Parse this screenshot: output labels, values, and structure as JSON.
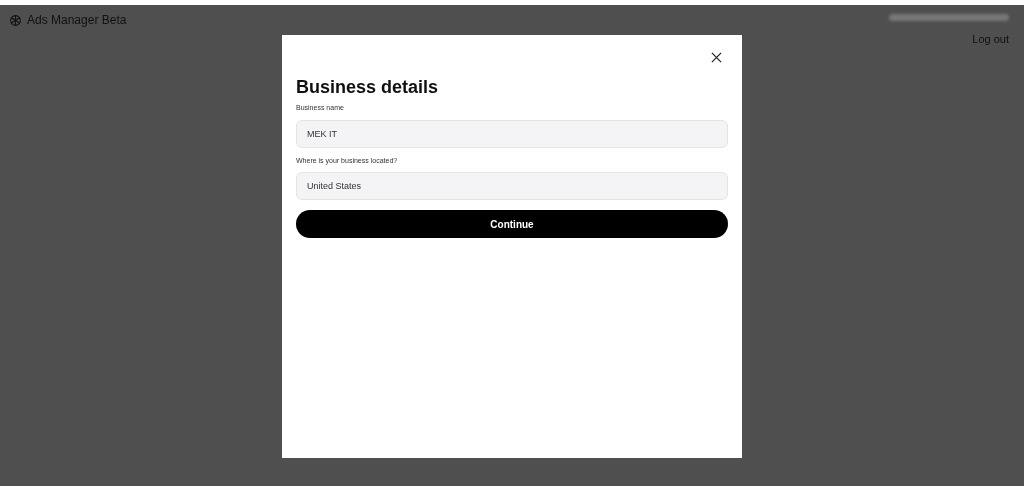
{
  "header": {
    "app_name": "Ads Manager Beta",
    "logout": "Log out"
  },
  "dialog": {
    "title": "Business details",
    "fields": [
      {
        "label": "Business name",
        "value": "MEK IT"
      },
      {
        "label": "Where is your business located?",
        "value": "United States"
      }
    ],
    "button": "Continue"
  }
}
